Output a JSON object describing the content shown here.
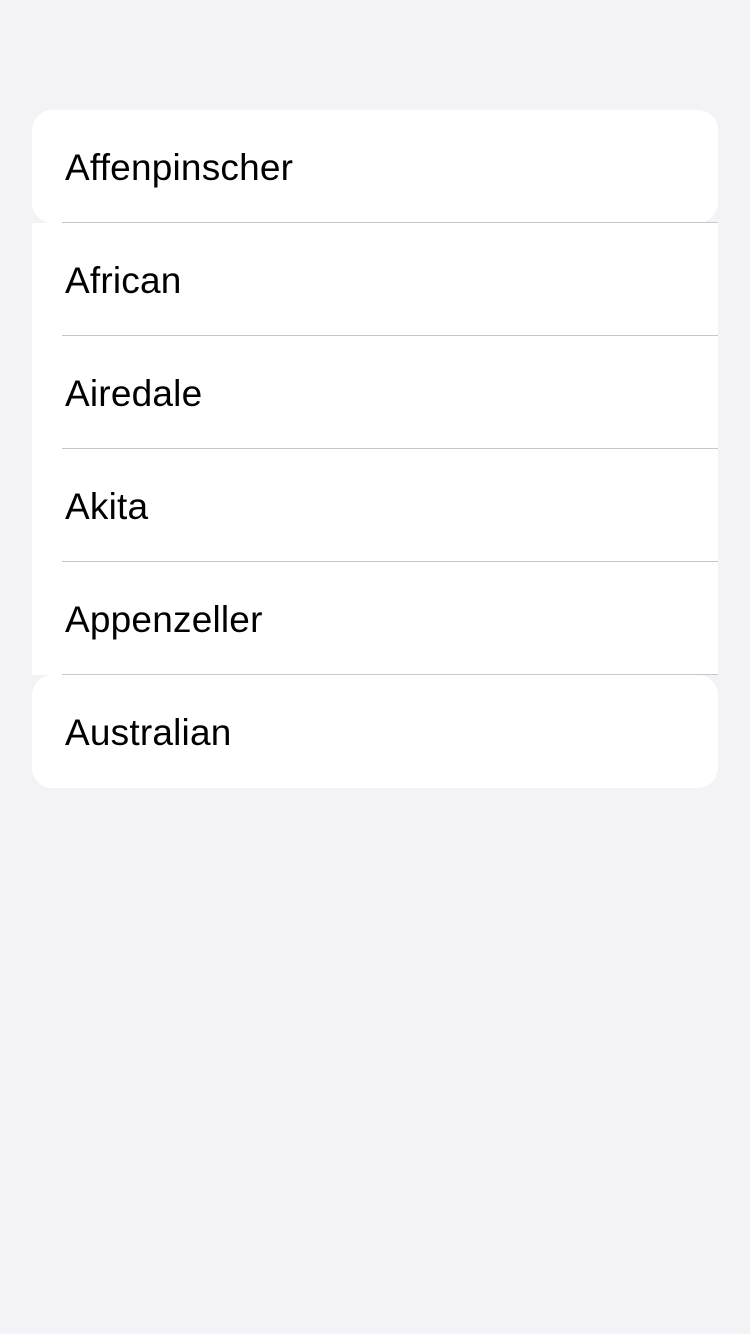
{
  "breed_list": {
    "items": [
      {
        "label": "Affenpinscher"
      },
      {
        "label": "African"
      },
      {
        "label": "Airedale"
      },
      {
        "label": "Akita"
      },
      {
        "label": "Appenzeller"
      },
      {
        "label": "Australian"
      }
    ]
  },
  "colors": {
    "background": "#f2f2f7",
    "row_background": "#ffffff",
    "separator": "#c8c8cc",
    "text": "#000000"
  }
}
